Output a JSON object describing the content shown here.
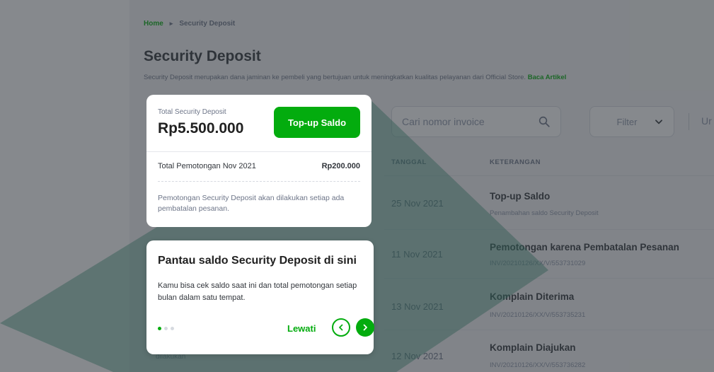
{
  "breadcrumb": {
    "home": "Home",
    "separator": "▸",
    "current": "Security Deposit"
  },
  "page": {
    "title": "Security Deposit",
    "description": "Security Deposit merupakan dana jaminan ke pembeli yang bertujuan untuk meningkatkan kualitas pelayanan dari Official Store.",
    "description_link": "Baca Artikel"
  },
  "toolbar": {
    "search_placeholder": "Cari nomor invoice",
    "filter_label": "Filter",
    "sort_label": "Ur"
  },
  "table": {
    "headers": {
      "date": "TANGGAL",
      "description": "KETERANGAN"
    },
    "rows": [
      {
        "date": "25 Nov 2021",
        "title": "Top-up Saldo",
        "subtitle": "Penambahan saldo Security Deposit"
      },
      {
        "date": "11 Nov 2021",
        "title": "Pemotongan karena Pembatalan Pesanan",
        "subtitle": "INV/20210126/XX/V/553731029"
      },
      {
        "date": "13 Nov 2021",
        "title": "Komplain Diterima",
        "subtitle": "INV/20210126/XX/V/553735231"
      },
      {
        "date": "12 Nov 2021",
        "title": "Komplain Diajukan",
        "subtitle": "INV/20210126/XX/V/553736282"
      }
    ],
    "partial_text": "dilakukan"
  },
  "deposit_card": {
    "label": "Total Security Deposit",
    "amount": "Rp5.500.000",
    "topup_button": "Top-up Saldo",
    "cut_label": "Total Pemotongan Nov 2021",
    "cut_value": "Rp200.000",
    "note": "Pemotongan Security Deposit akan dilakukan setiap ada pembatalan pesanan."
  },
  "coachmark": {
    "title": "Pantau saldo Security Deposit di sini",
    "body": "Kamu bisa cek saldo saat ini dan total pemotongan setiap bulan dalam satu tempat.",
    "skip_label": "Lewati",
    "total_steps": 3,
    "current_step": 1
  },
  "colors": {
    "brand_green": "#03ac0e",
    "overlay": "#2e343a",
    "watermark_stripe": "#2f5a52"
  }
}
